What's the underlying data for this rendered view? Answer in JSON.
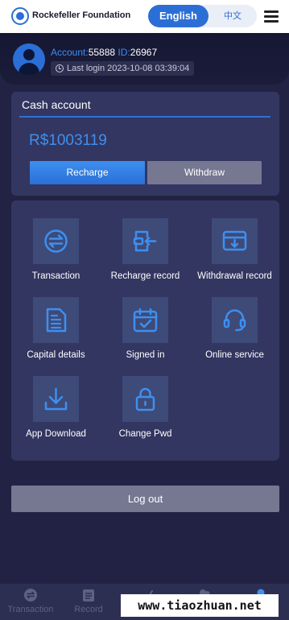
{
  "header": {
    "brand": "Rockefeller Foundation",
    "lang_en": "English",
    "lang_zh": "中文"
  },
  "profile": {
    "account_key": "Account:",
    "account_value": "55888",
    "id_key": "ID:",
    "id_value": "26967",
    "last_login": "Last login 2023-10-08 03:39:04"
  },
  "cash": {
    "title": "Cash account",
    "balance": "R$1003119",
    "recharge_label": "Recharge",
    "withdraw_label": "Withdraw"
  },
  "menu": {
    "items": [
      {
        "label": "Transaction",
        "icon": "transfer-icon"
      },
      {
        "label": "Recharge record",
        "icon": "recharge-record-icon"
      },
      {
        "label": "Withdrawal record",
        "icon": "withdrawal-record-icon"
      },
      {
        "label": "Capital details",
        "icon": "document-icon"
      },
      {
        "label": "Signed in",
        "icon": "calendar-check-icon"
      },
      {
        "label": "Online service",
        "icon": "headset-icon"
      },
      {
        "label": "App Download",
        "icon": "download-icon"
      },
      {
        "label": "Change Pwd",
        "icon": "lock-icon"
      }
    ]
  },
  "logout_label": "Log out",
  "tabbar": {
    "items": [
      {
        "label": "Transaction",
        "icon": "transfer-icon"
      },
      {
        "label": "Record",
        "icon": "clipboard-icon"
      },
      {
        "label": "",
        "icon": "chart-icon"
      },
      {
        "label": "",
        "icon": "team-icon"
      },
      {
        "label": "",
        "icon": "user-icon"
      }
    ]
  },
  "watermark": "www.tiaozhuan.net",
  "colors": {
    "accent": "#2b6fd6",
    "accent_light": "#3d8ff0",
    "background": "#222344",
    "card": "#333660",
    "tile": "#3e4a78",
    "muted_button": "#767892"
  }
}
